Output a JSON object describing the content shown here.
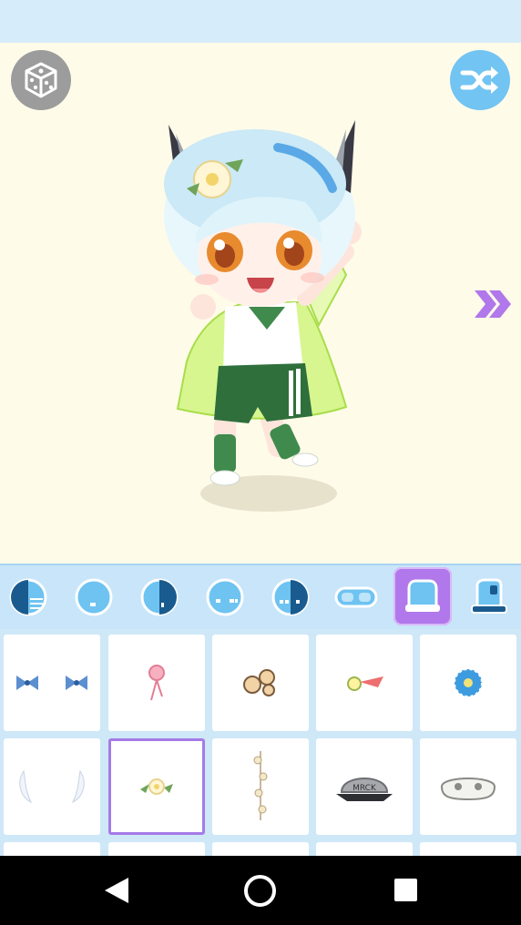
{
  "toolbar": {
    "random_icon": "dice-icon",
    "shuffle_icon": "shuffle-icon",
    "next_icon": "double-chevron-right-icon"
  },
  "tabs": [
    {
      "icon": "eyes-style-1-icon",
      "active": false
    },
    {
      "icon": "eyes-style-2-icon",
      "active": false
    },
    {
      "icon": "eyes-style-3-icon",
      "active": false
    },
    {
      "icon": "eyes-style-4-icon",
      "active": false
    },
    {
      "icon": "eyes-style-5-icon",
      "active": false
    },
    {
      "icon": "glasses-icon",
      "active": false
    },
    {
      "icon": "hat-accessory-icon",
      "active": true
    },
    {
      "icon": "hat-icon",
      "active": false
    }
  ],
  "items": [
    {
      "icon": "blue-bows-icon",
      "selected": false
    },
    {
      "icon": "pink-lollipop-clip-icon",
      "selected": false
    },
    {
      "icon": "flower-clip-icon",
      "selected": false
    },
    {
      "icon": "fish-hairpin-icon",
      "selected": false
    },
    {
      "icon": "blue-flower-icon",
      "selected": false
    },
    {
      "icon": "angel-wings-icon",
      "selected": false
    },
    {
      "icon": "white-flower-crown-icon",
      "selected": true
    },
    {
      "icon": "dangling-earring-icon",
      "selected": false
    },
    {
      "icon": "baseball-cap-icon",
      "selected": false,
      "text": "MRCK"
    },
    {
      "icon": "skull-mask-icon",
      "selected": false
    }
  ],
  "nav": {
    "back_icon": "back-triangle-icon",
    "home_icon": "home-circle-icon",
    "recents_icon": "recents-square-icon"
  },
  "colors": {
    "stage_bg": "#fffbe9",
    "bar_blue": "#c8e5f9",
    "accent_purple": "#b078ea",
    "shuffle_blue": "#72c4f2"
  }
}
